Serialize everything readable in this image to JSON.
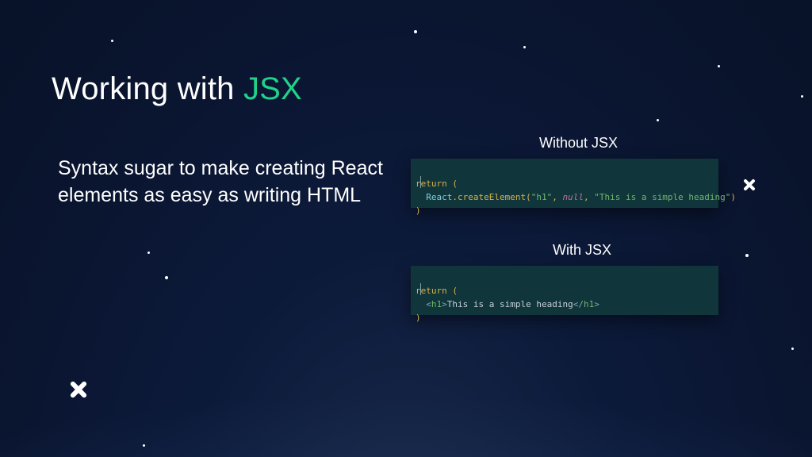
{
  "title": {
    "prefix": "Working with ",
    "accent": "JSX"
  },
  "subtitle": "Syntax sugar to make creating React elements as easy as writing HTML",
  "panels": {
    "without": {
      "label": "Without JSX",
      "code": {
        "l1_return": "return",
        "l1_open": " (",
        "l2_indent": "  ",
        "l2_obj": "React",
        "l2_dot": ".",
        "l2_fn": "createElement",
        "l2_p1": "(",
        "l2_s1": "\"h1\"",
        "l2_c1": ", ",
        "l2_null": "null",
        "l2_c2": ", ",
        "l2_s2": "\"This is a simple heading\"",
        "l2_p2": ")",
        "l3_close": ")"
      }
    },
    "with": {
      "label": "With JSX",
      "code": {
        "l1_return": "return",
        "l1_open": " (",
        "l2_indent": "  ",
        "l2_a1": "<",
        "l2_tag1": "h1",
        "l2_a2": ">",
        "l2_txt": "This is a simple heading",
        "l2_a3": "</",
        "l2_tag2": "h1",
        "l2_a4": ">",
        "l3_close": ")"
      }
    }
  }
}
